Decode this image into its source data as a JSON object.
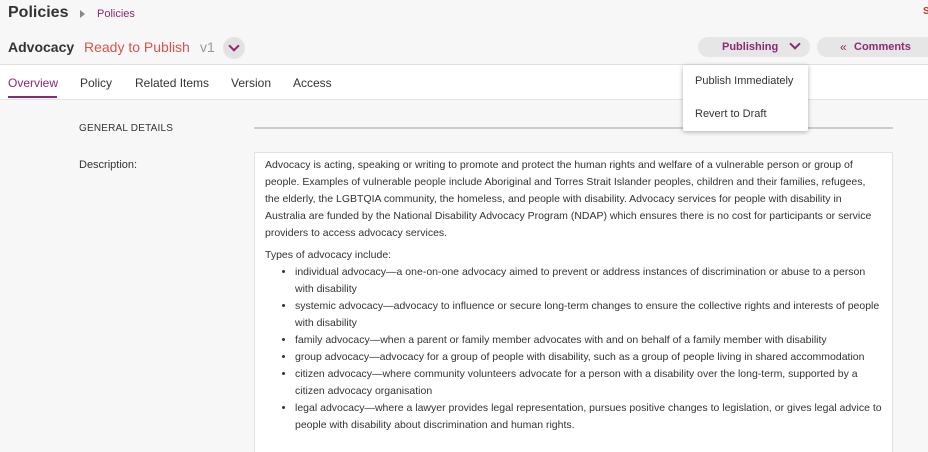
{
  "app": {
    "title": "Policies",
    "breadcrumb": "Policies",
    "corner_mark": "S"
  },
  "record": {
    "title": "Advocacy",
    "status": "Ready to Publish",
    "version": "v1"
  },
  "actions": {
    "publishing": "Publishing",
    "comments_icon": "«",
    "comments": "Comments"
  },
  "tabs": [
    {
      "label": "Overview",
      "active": true
    },
    {
      "label": "Policy"
    },
    {
      "label": "Related Items"
    },
    {
      "label": "Version"
    },
    {
      "label": "Access"
    }
  ],
  "publish_menu": {
    "items": [
      "Publish Immediately",
      "Revert to Draft"
    ]
  },
  "general": {
    "section_title": "GENERAL DETAILS",
    "description_label": "Description:",
    "paragraph": "Advocacy is acting, speaking or writing to promote and protect the human rights and welfare of a vulnerable person or group of people. Examples of vulnerable people include Aboriginal and Torres Strait Islander peoples, children and their families, refugees, the elderly, the LGBTQIA community, the homeless, and people with disability. Advocacy services for people with disability in Australia are funded by the National Disability Advocacy Program (NDAP) which ensures there is no cost for participants or service providers to access advocacy services.",
    "types_heading": "Types of advocacy include:",
    "types": [
      "individual advocacy—a one-on-one advocacy aimed to prevent or address instances of discrimination or abuse to a person with disability",
      "systemic advocacy—advocacy to influence or secure long-term changes to ensure the collective rights and interests of people with disability",
      "family advocacy—when a parent or family member advocates with and on behalf of a family member with disability",
      "group advocacy—advocacy for a group of people with disability, such as a group of people living in shared accommodation",
      "citizen advocacy—where community volunteers advocate for a person with a disability over the long-term, supported by a citizen advocacy organisation",
      "legal advocacy—where a lawyer provides legal representation, pursues positive changes to legislation, or gives legal advice to people with disability about discrimination and human rights."
    ]
  },
  "colors": {
    "accent": "#8b2a72",
    "status": "#d9534f"
  }
}
